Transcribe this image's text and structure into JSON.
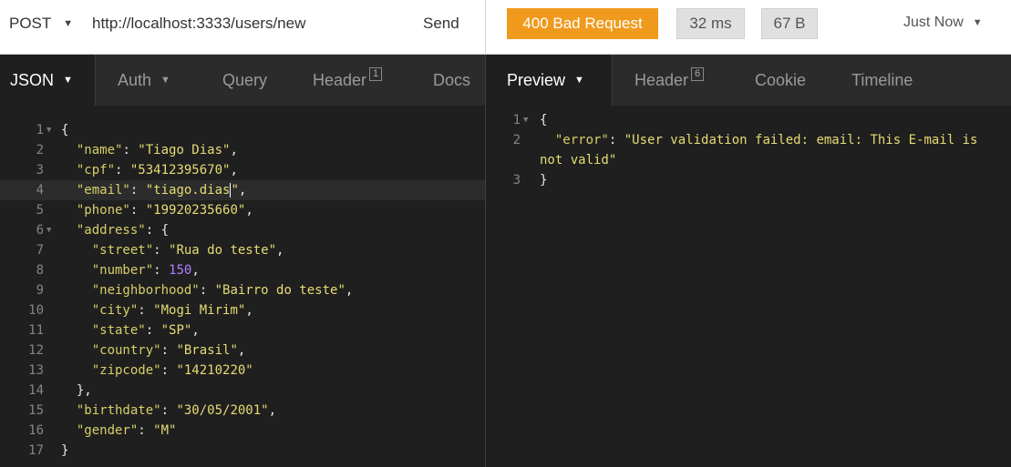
{
  "request": {
    "method": "POST",
    "url": "http://localhost:3333/users/new",
    "send_label": "Send"
  },
  "response": {
    "status": "400 Bad Request",
    "time": "32 ms",
    "size": "67 B",
    "history": "Just Now",
    "status_color": "#f09a1d"
  },
  "request_tabs": {
    "body": "JSON",
    "auth": "Auth",
    "query": "Query",
    "header": "Header",
    "header_count": "1",
    "docs": "Docs"
  },
  "response_tabs": {
    "preview": "Preview",
    "header": "Header",
    "header_count": "6",
    "cookie": "Cookie",
    "timeline": "Timeline"
  },
  "request_body": [
    {
      "num": "1",
      "fold": true,
      "indent": 0,
      "parts": [
        {
          "t": "{",
          "c": "p"
        }
      ]
    },
    {
      "num": "2",
      "indent": 1,
      "parts": [
        {
          "t": "\"name\"",
          "c": "k"
        },
        {
          "t": ": ",
          "c": "p"
        },
        {
          "t": "\"Tiago Dias\"",
          "c": "s"
        },
        {
          "t": ",",
          "c": "p"
        }
      ]
    },
    {
      "num": "3",
      "indent": 1,
      "parts": [
        {
          "t": "\"cpf\"",
          "c": "k"
        },
        {
          "t": ": ",
          "c": "p"
        },
        {
          "t": "\"53412395670\"",
          "c": "s"
        },
        {
          "t": ",",
          "c": "p"
        }
      ]
    },
    {
      "num": "4",
      "indent": 1,
      "highlight": true,
      "cursor_after": 2,
      "parts": [
        {
          "t": "\"email\"",
          "c": "k"
        },
        {
          "t": ": ",
          "c": "p"
        },
        {
          "t": "\"tiago.dias",
          "c": "s"
        },
        {
          "t": "\"",
          "c": "s"
        },
        {
          "t": ",",
          "c": "p"
        }
      ]
    },
    {
      "num": "5",
      "indent": 1,
      "parts": [
        {
          "t": "\"phone\"",
          "c": "k"
        },
        {
          "t": ": ",
          "c": "p"
        },
        {
          "t": "\"19920235660\"",
          "c": "s"
        },
        {
          "t": ",",
          "c": "p"
        }
      ]
    },
    {
      "num": "6",
      "fold": true,
      "indent": 1,
      "parts": [
        {
          "t": "\"address\"",
          "c": "k"
        },
        {
          "t": ": {",
          "c": "p"
        }
      ]
    },
    {
      "num": "7",
      "indent": 2,
      "parts": [
        {
          "t": "\"street\"",
          "c": "k"
        },
        {
          "t": ": ",
          "c": "p"
        },
        {
          "t": "\"Rua do teste\"",
          "c": "s"
        },
        {
          "t": ",",
          "c": "p"
        }
      ]
    },
    {
      "num": "8",
      "indent": 2,
      "parts": [
        {
          "t": "\"number\"",
          "c": "k"
        },
        {
          "t": ": ",
          "c": "p"
        },
        {
          "t": "150",
          "c": "n"
        },
        {
          "t": ",",
          "c": "p"
        }
      ]
    },
    {
      "num": "9",
      "indent": 2,
      "parts": [
        {
          "t": "\"neighborhood\"",
          "c": "k"
        },
        {
          "t": ": ",
          "c": "p"
        },
        {
          "t": "\"Bairro do teste\"",
          "c": "s"
        },
        {
          "t": ",",
          "c": "p"
        }
      ]
    },
    {
      "num": "10",
      "indent": 2,
      "parts": [
        {
          "t": "\"city\"",
          "c": "k"
        },
        {
          "t": ": ",
          "c": "p"
        },
        {
          "t": "\"Mogi Mirim\"",
          "c": "s"
        },
        {
          "t": ",",
          "c": "p"
        }
      ]
    },
    {
      "num": "11",
      "indent": 2,
      "parts": [
        {
          "t": "\"state\"",
          "c": "k"
        },
        {
          "t": ": ",
          "c": "p"
        },
        {
          "t": "\"SP\"",
          "c": "s"
        },
        {
          "t": ",",
          "c": "p"
        }
      ]
    },
    {
      "num": "12",
      "indent": 2,
      "parts": [
        {
          "t": "\"country\"",
          "c": "k"
        },
        {
          "t": ": ",
          "c": "p"
        },
        {
          "t": "\"Brasil\"",
          "c": "s"
        },
        {
          "t": ",",
          "c": "p"
        }
      ]
    },
    {
      "num": "13",
      "indent": 2,
      "parts": [
        {
          "t": "\"zipcode\"",
          "c": "k"
        },
        {
          "t": ": ",
          "c": "p"
        },
        {
          "t": "\"14210220\"",
          "c": "s"
        }
      ]
    },
    {
      "num": "14",
      "indent": 1,
      "parts": [
        {
          "t": "},",
          "c": "p"
        }
      ]
    },
    {
      "num": "15",
      "indent": 1,
      "parts": [
        {
          "t": "\"birthdate\"",
          "c": "k"
        },
        {
          "t": ": ",
          "c": "p"
        },
        {
          "t": "\"30/05/2001\"",
          "c": "s"
        },
        {
          "t": ",",
          "c": "p"
        }
      ]
    },
    {
      "num": "16",
      "indent": 1,
      "parts": [
        {
          "t": "\"gender\"",
          "c": "k"
        },
        {
          "t": ": ",
          "c": "p"
        },
        {
          "t": "\"M\"",
          "c": "s"
        }
      ]
    },
    {
      "num": "17",
      "indent": 0,
      "parts": [
        {
          "t": "}",
          "c": "p"
        }
      ]
    }
  ],
  "response_body": [
    {
      "num": "1",
      "fold": true,
      "indent": 0,
      "parts": [
        {
          "t": "{",
          "c": "p"
        }
      ]
    },
    {
      "num": "2",
      "indent": 1,
      "parts": [
        {
          "t": "\"error\"",
          "c": "k"
        },
        {
          "t": ": ",
          "c": "p"
        },
        {
          "t": "\"User validation failed: email: This E-mail is",
          "c": "s"
        }
      ]
    },
    {
      "num": "",
      "indent": 0,
      "parts": [
        {
          "t": "not valid\"",
          "c": "s"
        }
      ]
    },
    {
      "num": "3",
      "indent": 0,
      "parts": [
        {
          "t": "}",
          "c": "p"
        }
      ]
    }
  ]
}
